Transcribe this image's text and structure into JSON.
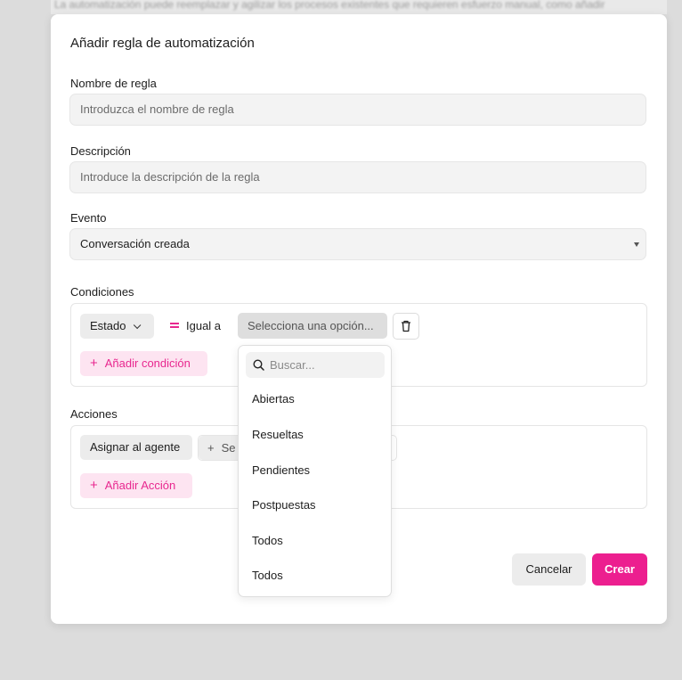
{
  "background": {
    "blurred_text": "La automatización puede reemplazar y agilizar los procesos existentes que requieren esfuerzo manual, como añadir"
  },
  "modal": {
    "title": "Añadir regla de automatización",
    "name_field": {
      "label": "Nombre de regla",
      "placeholder": "Introduzca el nombre de regla"
    },
    "description_field": {
      "label": "Descripción",
      "placeholder": "Introduce la descripción de la regla"
    },
    "event_field": {
      "label": "Evento",
      "value": "Conversación creada"
    },
    "conditions": {
      "label": "Condiciones",
      "attribute": "Estado",
      "operator": "Igual a",
      "value_placeholder": "Selecciona una opción...",
      "add_label": "Añadir condición"
    },
    "actions": {
      "label": "Acciones",
      "action": "Asignar al agente",
      "partial_select": "Se",
      "add_label": "Añadir Acción"
    },
    "buttons": {
      "cancel": "Cancelar",
      "create": "Crear"
    }
  },
  "dropdown": {
    "search_placeholder": "Buscar...",
    "options": [
      "Abiertas",
      "Resueltas",
      "Pendientes",
      "Postpuestas",
      "Todos",
      "Todos"
    ]
  },
  "colors": {
    "accent": "#ec1f8f",
    "accent_light": "#fde4f1"
  }
}
